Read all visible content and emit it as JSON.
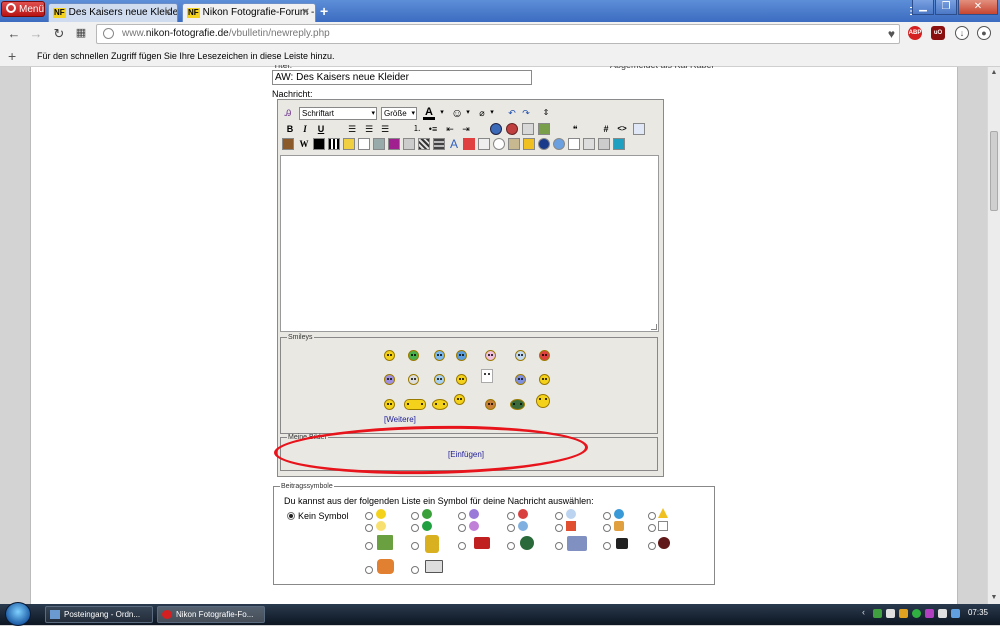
{
  "browser": {
    "menu_label": "Menü",
    "tabs": [
      {
        "icon": "NF",
        "label": "Des Kaisers neue Kleider -"
      },
      {
        "icon": "NF",
        "label": "Nikon Fotografie-Forum -"
      }
    ],
    "url_prefix": "www.",
    "url_domain": "nikon-fotografie.de",
    "url_path": "/vbulletin/newreply.php",
    "bookmark_hint": "Für den schnellen Zugriff fügen Sie Ihre Lesezeichen in diese Leiste hinzu.",
    "extensions": [
      "ABP",
      "uO"
    ]
  },
  "form": {
    "title_cut": "Titel:",
    "right_cut": "Abgemeldet als Kai Rabel",
    "subject_value": "AW: Des Kaisers neue Kleider",
    "message_label": "Nachricht:",
    "font_select": "Schriftart",
    "size_select": "Größe",
    "toolbar": {
      "bold": "B",
      "italic": "I",
      "underline": "U",
      "text_color": "A",
      "hash": "#",
      "code": "<>",
      "wiki": "W",
      "text_t": "T"
    }
  },
  "smileys": {
    "legend": "Smileys",
    "more_link": "[Weitere]"
  },
  "meine_bilder": {
    "legend": "Meine Bilder",
    "insert_link": "[Einfügen]"
  },
  "beitragssymbole": {
    "legend": "Beitragssymbole",
    "instruction": "Du kannst aus der folgenden Liste ein Symbol für deine Nachricht auswählen:",
    "no_symbol": "Kein Symbol"
  },
  "taskbar": {
    "tasks": [
      "Posteingang - Ordn...",
      "Nikon Fotografie-Fo..."
    ],
    "clock": "07:35"
  },
  "colors": {
    "annotation": "#e8141c",
    "link": "#22229a",
    "smiley": "#f4d21c"
  }
}
